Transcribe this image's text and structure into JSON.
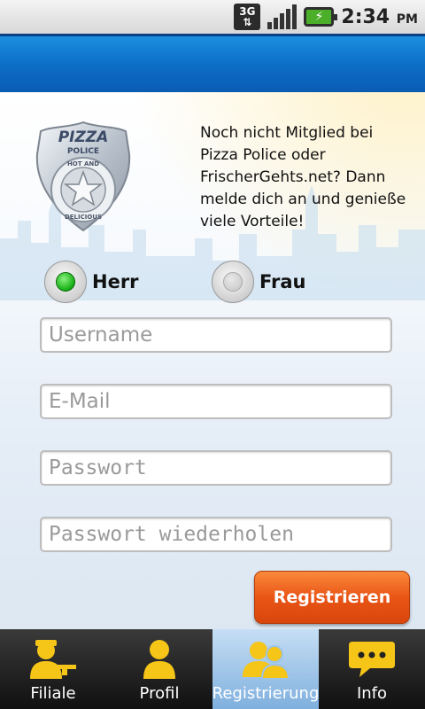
{
  "statusbar": {
    "network": "3G",
    "time": "2:34",
    "ampm": "PM"
  },
  "intro": {
    "text": "Noch nicht Mitglied bei Pizza Police oder FrischerGehts.net? Dann melde dich an und genieße viele Vorteile!"
  },
  "logo": {
    "line1": "PIZZA",
    "line2": "POLICE",
    "ring_top": "HOT AND",
    "ring_bottom": "DELICIOUS"
  },
  "gender": {
    "options": [
      {
        "label": "Herr",
        "selected": true
      },
      {
        "label": "Frau",
        "selected": false
      }
    ]
  },
  "form": {
    "username_placeholder": "Username",
    "email_placeholder": "E-Mail",
    "password_placeholder": "Passwort",
    "password_repeat_placeholder": "Passwort wiederholen",
    "submit_label": "Registrieren"
  },
  "tabs": [
    {
      "label": "Filiale",
      "icon": "pizza-officer-icon",
      "active": false
    },
    {
      "label": "Profil",
      "icon": "person-icon",
      "active": false
    },
    {
      "label": "Registrierung",
      "icon": "people-icon",
      "active": true
    },
    {
      "label": "Info",
      "icon": "speech-bubble-icon",
      "active": false
    }
  ],
  "colors": {
    "header_blue": "#0c6cc6",
    "button_orange": "#e95516",
    "radio_green": "#1cb31a",
    "icon_yellow": "#f5c518"
  }
}
